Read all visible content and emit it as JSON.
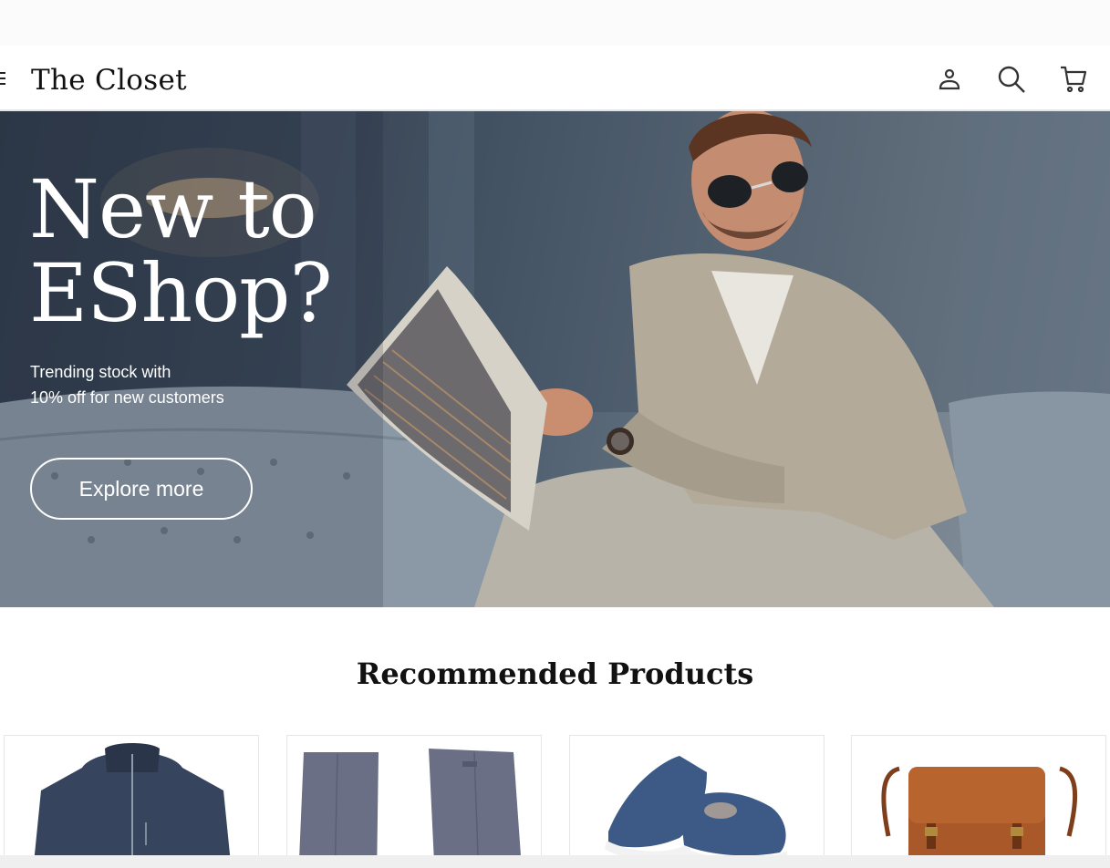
{
  "header": {
    "logo": "The Closet",
    "icons": [
      "menu-icon",
      "account-icon",
      "search-icon",
      "cart-icon"
    ]
  },
  "hero": {
    "title_line1": "New to",
    "title_line2": "EShop?",
    "subtitle_line1": "Trending stock with",
    "subtitle_line2": "10% off for new customers",
    "cta_label": "Explore more"
  },
  "recommended": {
    "title": "Recommended Products",
    "products": [
      {
        "kind": "navy-jacket",
        "color": "#36445e"
      },
      {
        "kind": "grey-trousers",
        "color": "#6b6f86"
      },
      {
        "kind": "navy-sneakers",
        "color": "#3d5a86"
      },
      {
        "kind": "leather-satchel",
        "color": "#a9582a"
      }
    ]
  },
  "colors": {
    "text": "#111111",
    "hero_text": "#ffffff",
    "divider": "#e4e4e4"
  }
}
